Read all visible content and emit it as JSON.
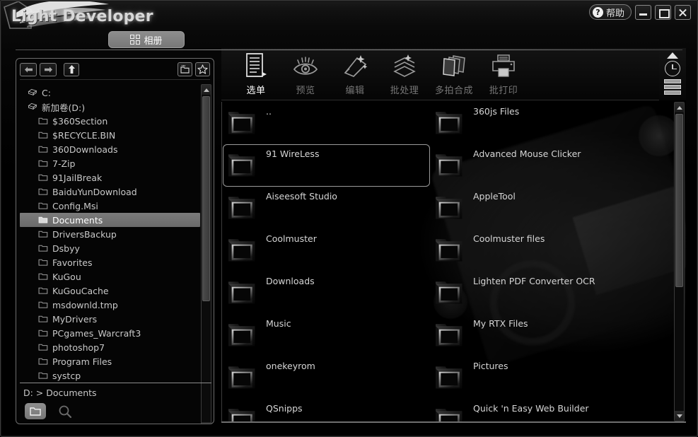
{
  "window": {
    "app_title": "Light Developer",
    "help_label": "帮助",
    "help_glyph": "?",
    "minimize_label": "",
    "maximize_label": "",
    "close_label": ""
  },
  "album_tab": {
    "label": "相册"
  },
  "toolbar": {
    "items": [
      {
        "label": "选单",
        "icon": "menu-document-icon",
        "active": true
      },
      {
        "label": "预览",
        "icon": "eye-preview-icon",
        "active": false
      },
      {
        "label": "编辑",
        "icon": "edit-magic-icon",
        "active": false
      },
      {
        "label": "批处理",
        "icon": "batch-process-icon",
        "active": false
      },
      {
        "label": "多拍合成",
        "icon": "multi-shot-merge-icon",
        "active": false
      },
      {
        "label": "批打印",
        "icon": "batch-print-icon",
        "active": false
      }
    ]
  },
  "edge_controls": {
    "collapse_label": "",
    "clock_label": "",
    "list_view_label": ""
  },
  "tree_panel": {
    "nav": {
      "back": "←",
      "forward": "→",
      "up": "↑",
      "new_folder": "new-folder-icon",
      "favorite": "star-icon"
    },
    "items": [
      {
        "label": "C:",
        "type": "drive",
        "depth": 0,
        "selected": false
      },
      {
        "label": "新加卷(D:)",
        "type": "drive",
        "depth": 0,
        "selected": false
      },
      {
        "label": "$360Section",
        "type": "folder",
        "depth": 1,
        "selected": false
      },
      {
        "label": "$RECYCLE.BIN",
        "type": "folder",
        "depth": 1,
        "selected": false
      },
      {
        "label": "360Downloads",
        "type": "folder",
        "depth": 1,
        "selected": false
      },
      {
        "label": "7-Zip",
        "type": "folder",
        "depth": 1,
        "selected": false
      },
      {
        "label": "91JailBreak",
        "type": "folder",
        "depth": 1,
        "selected": false
      },
      {
        "label": "BaiduYunDownload",
        "type": "folder",
        "depth": 1,
        "selected": false
      },
      {
        "label": "Config.Msi",
        "type": "folder",
        "depth": 1,
        "selected": false
      },
      {
        "label": "Documents",
        "type": "folder",
        "depth": 1,
        "selected": true
      },
      {
        "label": "DriversBackup",
        "type": "folder",
        "depth": 1,
        "selected": false
      },
      {
        "label": "Dsbyy",
        "type": "folder",
        "depth": 1,
        "selected": false
      },
      {
        "label": "Favorites",
        "type": "folder",
        "depth": 1,
        "selected": false
      },
      {
        "label": "KuGou",
        "type": "folder",
        "depth": 1,
        "selected": false
      },
      {
        "label": "KuGouCache",
        "type": "folder",
        "depth": 1,
        "selected": false
      },
      {
        "label": "msdownld.tmp",
        "type": "folder",
        "depth": 1,
        "selected": false
      },
      {
        "label": "MyDrivers",
        "type": "folder",
        "depth": 1,
        "selected": false
      },
      {
        "label": "PCgames_Warcraft3",
        "type": "folder",
        "depth": 1,
        "selected": false
      },
      {
        "label": "photoshop7",
        "type": "folder",
        "depth": 1,
        "selected": false
      },
      {
        "label": "Program Files",
        "type": "folder",
        "depth": 1,
        "selected": false
      },
      {
        "label": "systcp",
        "type": "folder",
        "depth": 1,
        "selected": false
      }
    ],
    "path": "D: > Documents",
    "bottom_buttons": {
      "browse": "folder-icon",
      "search": "search-icon"
    }
  },
  "file_list": {
    "items": [
      {
        "name": "..",
        "hover": false
      },
      {
        "name": "360js Files",
        "hover": false
      },
      {
        "name": "91 WireLess",
        "hover": true
      },
      {
        "name": "Advanced Mouse Clicker",
        "hover": false
      },
      {
        "name": "Aiseesoft Studio",
        "hover": false
      },
      {
        "name": "AppleTool",
        "hover": false
      },
      {
        "name": "Coolmuster",
        "hover": false
      },
      {
        "name": "Coolmuster files",
        "hover": false
      },
      {
        "name": "Downloads",
        "hover": false
      },
      {
        "name": "Lighten PDF Converter OCR",
        "hover": false
      },
      {
        "name": "Music",
        "hover": false
      },
      {
        "name": "My RTX Files",
        "hover": false
      },
      {
        "name": "onekeyrom",
        "hover": false
      },
      {
        "name": "Pictures",
        "hover": false
      },
      {
        "name": "QSnipps",
        "hover": false
      },
      {
        "name": "Quick 'n Easy Web Builder",
        "hover": false
      }
    ]
  },
  "colors": {
    "background": "#000000",
    "panel_border": "#6d6d6d",
    "selection": "#7b7b7b",
    "text_primary": "#d6d6d6",
    "text_dim": "#767676",
    "accent_tab": "#8d8d8d"
  }
}
